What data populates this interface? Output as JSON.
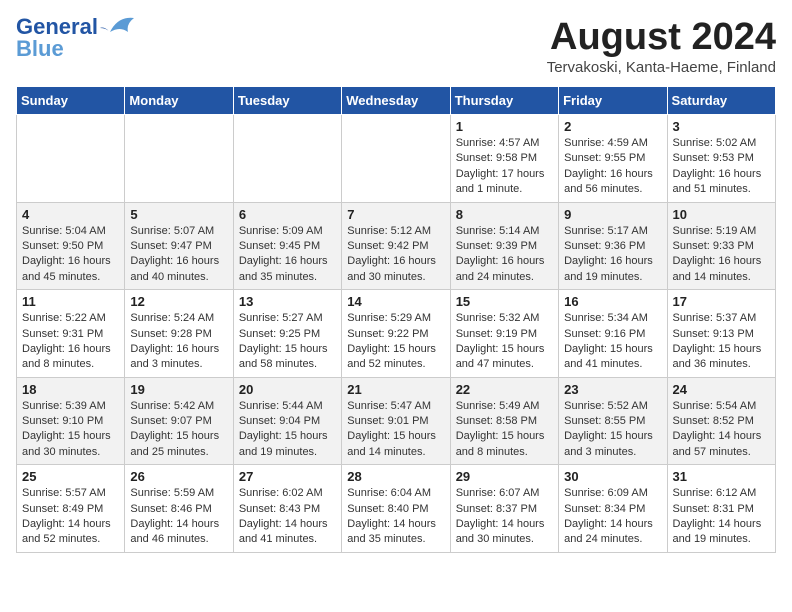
{
  "header": {
    "logo_line1": "General",
    "logo_line2": "Blue",
    "month": "August 2024",
    "location": "Tervakoski, Kanta-Haeme, Finland"
  },
  "weekdays": [
    "Sunday",
    "Monday",
    "Tuesday",
    "Wednesday",
    "Thursday",
    "Friday",
    "Saturday"
  ],
  "weeks": [
    [
      {
        "day": "",
        "info": ""
      },
      {
        "day": "",
        "info": ""
      },
      {
        "day": "",
        "info": ""
      },
      {
        "day": "",
        "info": ""
      },
      {
        "day": "1",
        "info": "Sunrise: 4:57 AM\nSunset: 9:58 PM\nDaylight: 17 hours\nand 1 minute."
      },
      {
        "day": "2",
        "info": "Sunrise: 4:59 AM\nSunset: 9:55 PM\nDaylight: 16 hours\nand 56 minutes."
      },
      {
        "day": "3",
        "info": "Sunrise: 5:02 AM\nSunset: 9:53 PM\nDaylight: 16 hours\nand 51 minutes."
      }
    ],
    [
      {
        "day": "4",
        "info": "Sunrise: 5:04 AM\nSunset: 9:50 PM\nDaylight: 16 hours\nand 45 minutes."
      },
      {
        "day": "5",
        "info": "Sunrise: 5:07 AM\nSunset: 9:47 PM\nDaylight: 16 hours\nand 40 minutes."
      },
      {
        "day": "6",
        "info": "Sunrise: 5:09 AM\nSunset: 9:45 PM\nDaylight: 16 hours\nand 35 minutes."
      },
      {
        "day": "7",
        "info": "Sunrise: 5:12 AM\nSunset: 9:42 PM\nDaylight: 16 hours\nand 30 minutes."
      },
      {
        "day": "8",
        "info": "Sunrise: 5:14 AM\nSunset: 9:39 PM\nDaylight: 16 hours\nand 24 minutes."
      },
      {
        "day": "9",
        "info": "Sunrise: 5:17 AM\nSunset: 9:36 PM\nDaylight: 16 hours\nand 19 minutes."
      },
      {
        "day": "10",
        "info": "Sunrise: 5:19 AM\nSunset: 9:33 PM\nDaylight: 16 hours\nand 14 minutes."
      }
    ],
    [
      {
        "day": "11",
        "info": "Sunrise: 5:22 AM\nSunset: 9:31 PM\nDaylight: 16 hours\nand 8 minutes."
      },
      {
        "day": "12",
        "info": "Sunrise: 5:24 AM\nSunset: 9:28 PM\nDaylight: 16 hours\nand 3 minutes."
      },
      {
        "day": "13",
        "info": "Sunrise: 5:27 AM\nSunset: 9:25 PM\nDaylight: 15 hours\nand 58 minutes."
      },
      {
        "day": "14",
        "info": "Sunrise: 5:29 AM\nSunset: 9:22 PM\nDaylight: 15 hours\nand 52 minutes."
      },
      {
        "day": "15",
        "info": "Sunrise: 5:32 AM\nSunset: 9:19 PM\nDaylight: 15 hours\nand 47 minutes."
      },
      {
        "day": "16",
        "info": "Sunrise: 5:34 AM\nSunset: 9:16 PM\nDaylight: 15 hours\nand 41 minutes."
      },
      {
        "day": "17",
        "info": "Sunrise: 5:37 AM\nSunset: 9:13 PM\nDaylight: 15 hours\nand 36 minutes."
      }
    ],
    [
      {
        "day": "18",
        "info": "Sunrise: 5:39 AM\nSunset: 9:10 PM\nDaylight: 15 hours\nand 30 minutes."
      },
      {
        "day": "19",
        "info": "Sunrise: 5:42 AM\nSunset: 9:07 PM\nDaylight: 15 hours\nand 25 minutes."
      },
      {
        "day": "20",
        "info": "Sunrise: 5:44 AM\nSunset: 9:04 PM\nDaylight: 15 hours\nand 19 minutes."
      },
      {
        "day": "21",
        "info": "Sunrise: 5:47 AM\nSunset: 9:01 PM\nDaylight: 15 hours\nand 14 minutes."
      },
      {
        "day": "22",
        "info": "Sunrise: 5:49 AM\nSunset: 8:58 PM\nDaylight: 15 hours\nand 8 minutes."
      },
      {
        "day": "23",
        "info": "Sunrise: 5:52 AM\nSunset: 8:55 PM\nDaylight: 15 hours\nand 3 minutes."
      },
      {
        "day": "24",
        "info": "Sunrise: 5:54 AM\nSunset: 8:52 PM\nDaylight: 14 hours\nand 57 minutes."
      }
    ],
    [
      {
        "day": "25",
        "info": "Sunrise: 5:57 AM\nSunset: 8:49 PM\nDaylight: 14 hours\nand 52 minutes."
      },
      {
        "day": "26",
        "info": "Sunrise: 5:59 AM\nSunset: 8:46 PM\nDaylight: 14 hours\nand 46 minutes."
      },
      {
        "day": "27",
        "info": "Sunrise: 6:02 AM\nSunset: 8:43 PM\nDaylight: 14 hours\nand 41 minutes."
      },
      {
        "day": "28",
        "info": "Sunrise: 6:04 AM\nSunset: 8:40 PM\nDaylight: 14 hours\nand 35 minutes."
      },
      {
        "day": "29",
        "info": "Sunrise: 6:07 AM\nSunset: 8:37 PM\nDaylight: 14 hours\nand 30 minutes."
      },
      {
        "day": "30",
        "info": "Sunrise: 6:09 AM\nSunset: 8:34 PM\nDaylight: 14 hours\nand 24 minutes."
      },
      {
        "day": "31",
        "info": "Sunrise: 6:12 AM\nSunset: 8:31 PM\nDaylight: 14 hours\nand 19 minutes."
      }
    ]
  ]
}
